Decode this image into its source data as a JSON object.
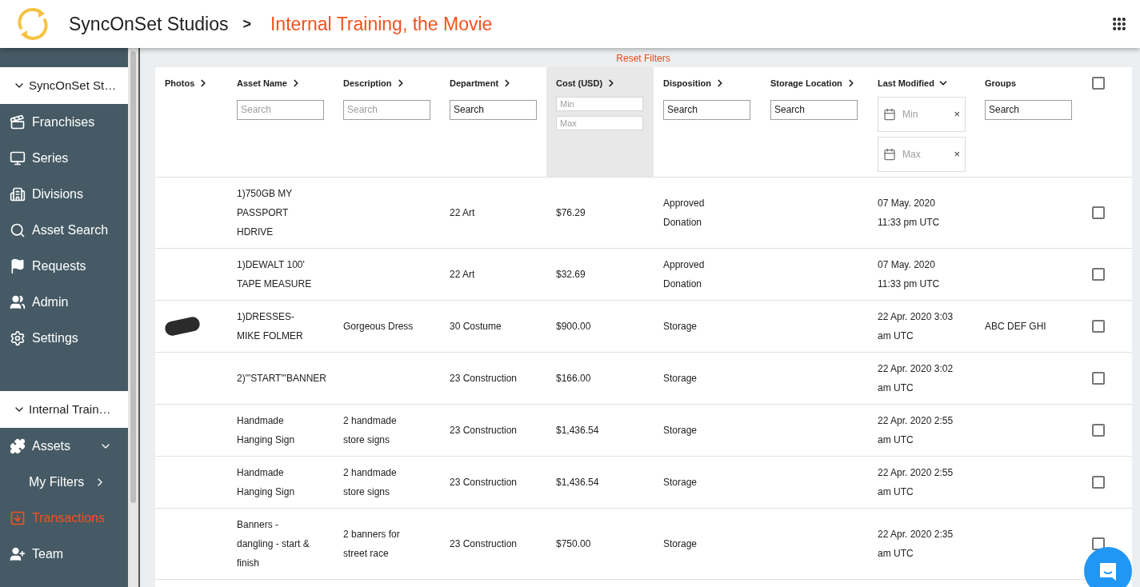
{
  "header": {
    "org": "SyncOnSet Studios",
    "separator": ">",
    "project": "Internal Training, the Movie"
  },
  "sidebar": {
    "items": [
      {
        "kind": "section",
        "label": "SyncOnSet St…",
        "expanded": true,
        "selected": false
      },
      {
        "kind": "nav",
        "label": "Franchises",
        "selected": false
      },
      {
        "kind": "nav",
        "label": "Series",
        "selected": false
      },
      {
        "kind": "nav",
        "label": "Divisions",
        "selected": false
      },
      {
        "kind": "nav",
        "label": "Asset Search",
        "selected": false
      },
      {
        "kind": "nav",
        "label": "Requests",
        "selected": false
      },
      {
        "kind": "nav",
        "label": "Admin",
        "selected": false
      },
      {
        "kind": "nav",
        "label": "Settings",
        "selected": false
      },
      {
        "kind": "gap"
      },
      {
        "kind": "section",
        "label": "Internal Train…",
        "expanded": true,
        "selected": false
      },
      {
        "kind": "nav",
        "label": "Assets",
        "expanded": true,
        "selected": false
      },
      {
        "kind": "sub",
        "label": "My Filters",
        "selected": false
      },
      {
        "kind": "nav",
        "label": "Transactions",
        "selected": true
      },
      {
        "kind": "nav",
        "label": "Team",
        "selected": false
      }
    ]
  },
  "reset_filters": "Reset Filters",
  "table": {
    "all_checked": false,
    "columns": [
      {
        "label": "Photos",
        "sortable": true,
        "sorted": false,
        "highlighted": false,
        "filter": {
          "kind": "none"
        }
      },
      {
        "label": "Asset Name",
        "sortable": true,
        "sorted": false,
        "highlighted": false,
        "filter": {
          "kind": "search",
          "placeholder": "Search"
        }
      },
      {
        "label": "Description",
        "sortable": true,
        "sorted": false,
        "highlighted": false,
        "filter": {
          "kind": "search",
          "placeholder": "Search"
        }
      },
      {
        "label": "Department",
        "sortable": true,
        "sorted": false,
        "highlighted": false,
        "filter": {
          "kind": "search",
          "value": "Search"
        }
      },
      {
        "label": "Cost (USD)",
        "sortable": true,
        "sorted": false,
        "highlighted": true,
        "filter": {
          "kind": "range",
          "min_placeholder": "Min",
          "max_placeholder": "Max"
        }
      },
      {
        "label": "Disposition",
        "sortable": true,
        "sorted": false,
        "highlighted": false,
        "filter": {
          "kind": "search",
          "value": "Search"
        }
      },
      {
        "label": "Storage Location",
        "sortable": true,
        "sorted": false,
        "highlighted": false,
        "filter": {
          "kind": "search",
          "value": "Search"
        }
      },
      {
        "label": "Last Modified",
        "sortable": true,
        "sorted": true,
        "highlighted": false,
        "filter": {
          "kind": "date_range",
          "min_placeholder": "Min",
          "max_placeholder": "Max",
          "clear": "×"
        }
      },
      {
        "label": "Groups",
        "sortable": false,
        "highlighted": false,
        "filter": {
          "kind": "search",
          "value": "Search"
        }
      }
    ],
    "rows": [
      {
        "photo": false,
        "cells": [
          "",
          "1)750GB MY PASSPORT HDRIVE",
          "",
          "22 Art",
          "$76.29",
          "Approved Donation",
          "",
          "07 May. 2020 11:33 pm UTC",
          ""
        ],
        "checked": false
      },
      {
        "photo": false,
        "cells": [
          "",
          "1)DEWALT 100' TAPE MEASURE",
          "",
          "22 Art",
          "$32.69",
          "Approved Donation",
          "",
          "07 May. 2020 11:33 pm UTC",
          ""
        ],
        "checked": false
      },
      {
        "photo": true,
        "cells": [
          "",
          "1)DRESSES-MIKE FOLMER",
          "Gorgeous Dress",
          "30 Costume",
          "$900.00",
          "Storage",
          "",
          "22 Apr. 2020 3:03 am UTC",
          "ABC DEF GHI"
        ],
        "checked": false
      },
      {
        "photo": false,
        "cells": [
          "",
          "2)\"'START\"'BANNER",
          "",
          "23 Construction",
          "$166.00",
          "Storage",
          "",
          "22 Apr. 2020 3:02 am UTC",
          ""
        ],
        "checked": false
      },
      {
        "photo": false,
        "cells": [
          "",
          "Handmade Hanging Sign",
          "2 handmade store signs",
          "23 Construction",
          "$1,436.54",
          "Storage",
          "",
          "22 Apr. 2020 2:55 am UTC",
          ""
        ],
        "checked": false
      },
      {
        "photo": false,
        "cells": [
          "",
          "Handmade Hanging Sign",
          "2 handmade store signs",
          "23 Construction",
          "$1,436.54",
          "Storage",
          "",
          "22 Apr. 2020 2:55 am UTC",
          ""
        ],
        "checked": false
      },
      {
        "photo": false,
        "cells": [
          "",
          "Banners - dangling - start & finish",
          "2 banners for street race",
          "23 Construction",
          "$750.00",
          "Storage",
          "",
          "22 Apr. 2020 2:35 am UTC",
          ""
        ],
        "checked": false
      }
    ]
  }
}
